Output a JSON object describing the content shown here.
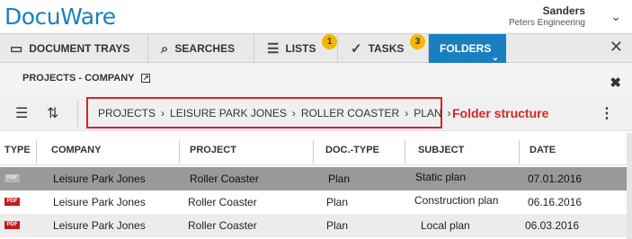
{
  "header": {
    "logo": "DocuWare",
    "user_name": "Sanders",
    "user_org": "Peters Engineering",
    "chevron": "⌄"
  },
  "tabs": [
    {
      "label": "Document Trays",
      "icon": "tray-icon",
      "glyph": "▭"
    },
    {
      "label": "Searches",
      "icon": "search-icon",
      "glyph": "⌕"
    },
    {
      "label": "Lists",
      "icon": "list-icon",
      "glyph": "☰",
      "badge": "1"
    },
    {
      "label": "Tasks",
      "icon": "check-icon",
      "glyph": "✓",
      "badge": "3"
    },
    {
      "label": "Folders",
      "icon": "folder-icon",
      "active": true
    }
  ],
  "close_glyph": "✕",
  "project": {
    "title": "PROJECTS - COMPANY",
    "ext_glyph": "↗",
    "close_glyph": "✖"
  },
  "toolbar": {
    "list_glyph": "☰",
    "sort_glyph": "⇅",
    "breadcrumb": [
      "PROJECTS",
      "LEISURE PARK JONES",
      "ROLLER COASTER",
      "PLAN"
    ],
    "crumb_sep": "›",
    "annotation": "Folder structure",
    "more_glyph": "⋮"
  },
  "table": {
    "headers": [
      "TYPE",
      "COMPANY",
      "PROJECT",
      "DOC.-TYPE",
      "SUBJECT",
      "DATE"
    ],
    "pdf_label": "PDF",
    "rows": [
      {
        "company": "Leisure Park Jones",
        "project": "Roller Coaster",
        "doctype": "Plan",
        "subject": "Static plan",
        "date": "07.01.2016"
      },
      {
        "company": "Leisure Park Jones",
        "project": "Roller Coaster",
        "doctype": "Plan",
        "subject": "Construction plan",
        "date": "06.16.2016"
      },
      {
        "company": "Leisure Park Jones",
        "project": "Roller Coaster",
        "doctype": "Plan",
        "subject": "Local plan",
        "date": "06.03.2016"
      }
    ]
  },
  "colors": {
    "brand": "#1a7fc1",
    "badge": "#f2b705",
    "annotation": "#d9232a"
  }
}
